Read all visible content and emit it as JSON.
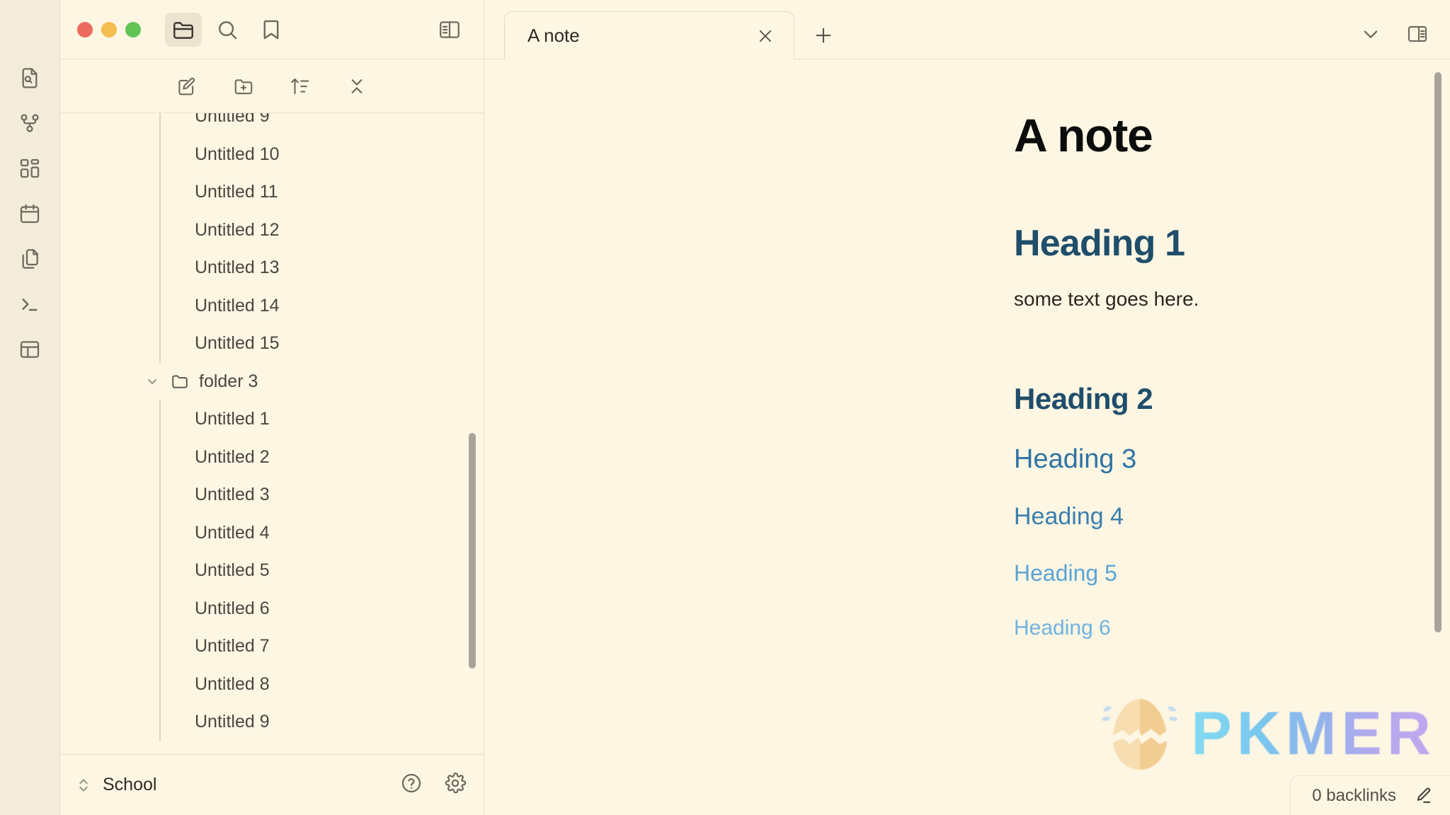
{
  "window": {
    "traffic_lights": [
      "close",
      "minimize",
      "zoom"
    ],
    "toolbar_icons": [
      {
        "name": "folder-icon",
        "label": "File explorer",
        "active": true
      },
      {
        "name": "search-icon",
        "label": "Search",
        "active": false
      },
      {
        "name": "bookmark-icon",
        "label": "Bookmarks",
        "active": false
      }
    ],
    "left_sidebar_toggle": "sidebar-left-icon"
  },
  "rail": {
    "items": [
      {
        "name": "file-search-icon",
        "label": "File search"
      },
      {
        "name": "graph-icon",
        "label": "Graph view"
      },
      {
        "name": "dashboard-grid-icon",
        "label": "Dashboard"
      },
      {
        "name": "calendar-icon",
        "label": "Calendar"
      },
      {
        "name": "copy-files-icon",
        "label": "Templates"
      },
      {
        "name": "terminal-icon",
        "label": "Terminal"
      },
      {
        "name": "layout-icon",
        "label": "Layout"
      }
    ]
  },
  "explorer": {
    "toolbar": [
      {
        "name": "new-note-icon",
        "label": "New note"
      },
      {
        "name": "new-folder-icon",
        "label": "New folder"
      },
      {
        "name": "sort-icon",
        "label": "Change sort order"
      },
      {
        "name": "collapse-all-icon",
        "label": "Collapse all"
      }
    ],
    "tree": [
      {
        "type": "file",
        "label": "Untitled 9"
      },
      {
        "type": "file",
        "label": "Untitled 10"
      },
      {
        "type": "file",
        "label": "Untitled 11"
      },
      {
        "type": "file",
        "label": "Untitled 12"
      },
      {
        "type": "file",
        "label": "Untitled 13"
      },
      {
        "type": "file",
        "label": "Untitled 14"
      },
      {
        "type": "file",
        "label": "Untitled 15"
      },
      {
        "type": "folder",
        "label": "folder 3",
        "expanded": true
      },
      {
        "type": "file",
        "label": "Untitled 1"
      },
      {
        "type": "file",
        "label": "Untitled 2"
      },
      {
        "type": "file",
        "label": "Untitled 3"
      },
      {
        "type": "file",
        "label": "Untitled 4"
      },
      {
        "type": "file",
        "label": "Untitled 5"
      },
      {
        "type": "file",
        "label": "Untitled 6"
      },
      {
        "type": "file",
        "label": "Untitled 7"
      },
      {
        "type": "file",
        "label": "Untitled 8"
      },
      {
        "type": "file",
        "label": "Untitled 9"
      }
    ]
  },
  "vault": {
    "name": "School",
    "switch_icon": "vault-switch-icon",
    "help_icon": "help-icon",
    "settings_icon": "gear-icon"
  },
  "tabs": {
    "items": [
      {
        "label": "A note",
        "active": true,
        "close_icon": "close-icon"
      }
    ],
    "add_icon": "plus-icon",
    "right_icons": [
      {
        "name": "chevron-down-icon",
        "label": "Tab list"
      },
      {
        "name": "sidebar-right-icon",
        "label": "Toggle right sidebar"
      }
    ]
  },
  "note": {
    "title": "A note",
    "blocks": [
      {
        "type": "h1",
        "text": "Heading 1"
      },
      {
        "type": "p",
        "text": "some text goes here."
      },
      {
        "type": "h2",
        "text": "Heading 2"
      },
      {
        "type": "h3",
        "text": "Heading 3"
      },
      {
        "type": "h4",
        "text": "Heading 4"
      },
      {
        "type": "h5",
        "text": "Heading 5"
      },
      {
        "type": "h6",
        "text": "Heading 6"
      }
    ]
  },
  "backlinks": {
    "label": "0 backlinks",
    "edit_icon": "edit-pencil-icon"
  },
  "watermark": {
    "text": "PKMER",
    "logo": "cracked-egg-icon"
  },
  "colors": {
    "background": "#fdf6e3",
    "rail_background": "#f3ecdb",
    "border": "#e6decb",
    "text": "#4a4640",
    "heading_dark": "#1f4e6b",
    "heading_mid": "#2f74a4",
    "heading_light": "#6fb3e0",
    "traffic_red": "#ed6a5e",
    "traffic_yellow": "#f4bd4f",
    "traffic_green": "#61c454",
    "scrollbar": "#a9a49b"
  }
}
